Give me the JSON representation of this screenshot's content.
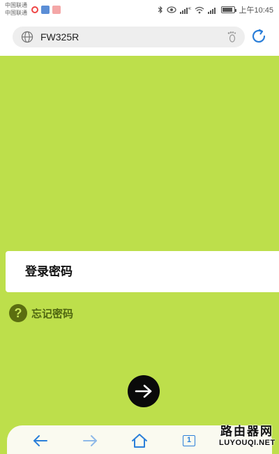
{
  "status_bar": {
    "carrier_1": "中国联通",
    "carrier_2": "中国联通",
    "network": "4G",
    "time": "上午10:45",
    "battery_level": 0.85,
    "icons": [
      "weibo-icon",
      "news-app-icon",
      "app-icon",
      "bluetooth-icon",
      "eye-icon",
      "signal-icon",
      "wifi-icon",
      "battery-icon"
    ]
  },
  "browser": {
    "url": "FW325R",
    "icons": [
      "globe-icon",
      "footprint-icon",
      "refresh-icon"
    ]
  },
  "login": {
    "password_placeholder": "登录密码",
    "forgot_label": "忘记密码",
    "help_glyph": "?"
  },
  "bottom_nav": {
    "tab_count": "1",
    "icons": [
      "back-arrow-icon",
      "forward-arrow-icon",
      "home-icon",
      "tabs-icon"
    ]
  },
  "watermark": {
    "cn": "路由器网",
    "en": "LUYOUQI.NET"
  },
  "colors": {
    "page_bg": "#bddf4b",
    "accent_blue": "#2b7fd9",
    "help_icon_bg": "#5b6e10",
    "forgot_text": "#4f6610"
  }
}
